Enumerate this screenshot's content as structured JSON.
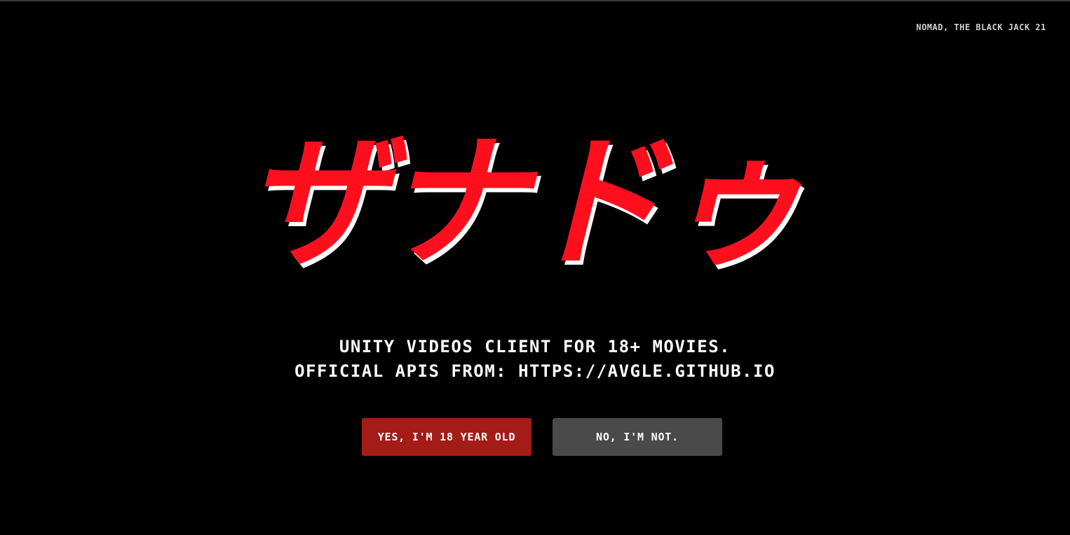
{
  "header": {
    "credit": "NOMAD, THE BLACK JACK 21"
  },
  "logo": {
    "text": "ザナドゥ"
  },
  "tagline": {
    "line1": "UNITY VIDEOS CLIENT FOR 18+ MOVIES.",
    "line2": "OFFICIAL APIS FROM:  HTTPS://AVGLE.GITHUB.IO"
  },
  "actions": {
    "yes_label": "YES, I'M 18 YEAR OLD",
    "no_label": "NO, I'M NOT."
  },
  "colors": {
    "background": "#000000",
    "logo_red": "#ff0f1e",
    "logo_shadow": "#ffffff",
    "yes_button": "#a41c17",
    "no_button": "#4a4a4a"
  }
}
